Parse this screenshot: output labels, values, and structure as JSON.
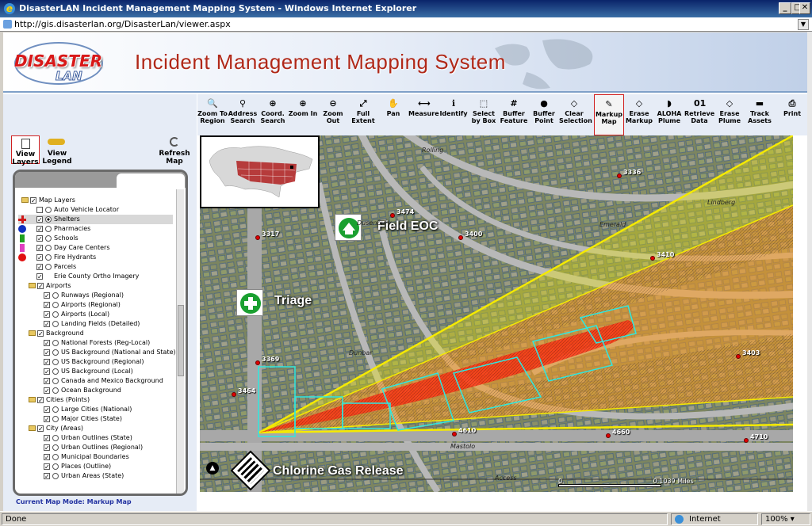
{
  "window": {
    "title": "DisasterLAN Incident Management Mapping System - Windows Internet Explorer",
    "url": "http://gis.disasterlan.org/DisasterLan/viewer.aspx"
  },
  "banner": {
    "logo_top": "DISASTER",
    "logo_bottom": "LAN",
    "title": "Incident Management Mapping System"
  },
  "left_buttons": {
    "view_layers": "View Layers",
    "view_legend": "View Legend",
    "refresh_map": "Refresh Map"
  },
  "layers": [
    {
      "label": "Map Layers",
      "kind": "folder",
      "indent": 0
    },
    {
      "label": "Auto Vehicle Locator",
      "kind": "layer",
      "indent": 1,
      "checked": false
    },
    {
      "label": "Shelters",
      "kind": "layer",
      "indent": 1,
      "checked": true,
      "selected": true,
      "symbol": "cross"
    },
    {
      "label": "Pharmacies",
      "kind": "layer",
      "indent": 1,
      "checked": true,
      "symbol": "blue-circle"
    },
    {
      "label": "Schools",
      "kind": "layer",
      "indent": 1,
      "checked": true,
      "symbol": "green-flag"
    },
    {
      "label": "Day Care Centers",
      "kind": "layer",
      "indent": 1,
      "checked": true,
      "symbol": "pink-flag"
    },
    {
      "label": "Fire Hydrants",
      "kind": "layer",
      "indent": 1,
      "checked": true,
      "symbol": "red-circle"
    },
    {
      "label": "Parcels",
      "kind": "layer",
      "indent": 1,
      "checked": true
    },
    {
      "label": "Erie County Ortho Imagery",
      "kind": "layer",
      "indent": 1,
      "checked": true,
      "noradio": true
    },
    {
      "label": "Airports",
      "kind": "folder",
      "indent": 1
    },
    {
      "label": "Runways (Regional)",
      "kind": "layer",
      "indent": 2,
      "checked": true
    },
    {
      "label": "Airports (Regional)",
      "kind": "layer",
      "indent": 2,
      "checked": true
    },
    {
      "label": "Airports (Local)",
      "kind": "layer",
      "indent": 2,
      "checked": true
    },
    {
      "label": "Landing Fields (Detailed)",
      "kind": "layer",
      "indent": 2,
      "checked": true
    },
    {
      "label": "Background",
      "kind": "folder",
      "indent": 1
    },
    {
      "label": "National Forests (Reg-Local)",
      "kind": "layer",
      "indent": 2,
      "checked": true
    },
    {
      "label": "US Background (National and State)",
      "kind": "layer",
      "indent": 2,
      "checked": true
    },
    {
      "label": "US Background (Regional)",
      "kind": "layer",
      "indent": 2,
      "checked": true
    },
    {
      "label": "US Background (Local)",
      "kind": "layer",
      "indent": 2,
      "checked": true
    },
    {
      "label": "Canada and Mexico Background",
      "kind": "layer",
      "indent": 2,
      "checked": true
    },
    {
      "label": "Ocean Background",
      "kind": "layer",
      "indent": 2,
      "checked": true
    },
    {
      "label": "Cities (Points)",
      "kind": "folder",
      "indent": 1
    },
    {
      "label": "Large Cities (National)",
      "kind": "layer",
      "indent": 2,
      "checked": true
    },
    {
      "label": "Major Cities (State)",
      "kind": "layer",
      "indent": 2,
      "checked": true
    },
    {
      "label": "City (Areas)",
      "kind": "folder",
      "indent": 1
    },
    {
      "label": "Urban Outlines (State)",
      "kind": "layer",
      "indent": 2,
      "checked": true
    },
    {
      "label": "Urban Outlines (Regional)",
      "kind": "layer",
      "indent": 2,
      "checked": true
    },
    {
      "label": "Municipal Boundaries",
      "kind": "layer",
      "indent": 2,
      "checked": true
    },
    {
      "label": "Places (Outline)",
      "kind": "layer",
      "indent": 2,
      "checked": true
    },
    {
      "label": "Urban Areas (State)",
      "kind": "layer",
      "indent": 2,
      "checked": true
    }
  ],
  "map_mode": "Current Map Mode: Markup Map",
  "tools": [
    {
      "label": "Zoom To Region",
      "icon": "zoom-region-icon",
      "glyph": "🔍"
    },
    {
      "label": "Address Search",
      "icon": "binoculars-icon",
      "glyph": "⚲"
    },
    {
      "label": "Coord. Search",
      "icon": "crosshair-icon",
      "glyph": "⊕"
    },
    {
      "label": "Zoom In",
      "icon": "zoom-in-icon",
      "glyph": "⊕"
    },
    {
      "label": "Zoom Out",
      "icon": "zoom-out-icon",
      "glyph": "⊖"
    },
    {
      "label": "Full Extent",
      "icon": "full-extent-icon",
      "glyph": "⤢"
    },
    {
      "label": "Pan",
      "icon": "hand-icon",
      "glyph": "✋"
    },
    {
      "label": "Measure",
      "icon": "measure-icon",
      "glyph": "⟷"
    },
    {
      "label": "Identify",
      "icon": "info-icon",
      "glyph": "ℹ"
    },
    {
      "label": "Select by Box",
      "icon": "select-box-icon",
      "glyph": "⬚"
    },
    {
      "label": "Buffer Feature",
      "icon": "buffer-feature-icon",
      "glyph": "#"
    },
    {
      "label": "Buffer Point",
      "icon": "buffer-point-icon",
      "glyph": "●"
    },
    {
      "label": "Clear Selection",
      "icon": "clear-selection-icon",
      "glyph": "◇"
    },
    {
      "label": "Markup Map",
      "icon": "pencil-icon",
      "glyph": "✎",
      "active": true
    },
    {
      "label": "Erase Markup",
      "icon": "eraser-icon",
      "glyph": "◇"
    },
    {
      "label": "ALOHA Plume",
      "icon": "plume-icon",
      "glyph": "◗"
    },
    {
      "label": "Retrieve Data",
      "icon": "binary-data-icon",
      "glyph": "01"
    },
    {
      "label": "Erase Plume",
      "icon": "erase-plume-icon",
      "glyph": "◇"
    },
    {
      "label": "Track Assets",
      "icon": "truck-icon",
      "glyph": "▬"
    },
    {
      "label": "Print",
      "icon": "printer-icon",
      "glyph": "⎙"
    }
  ],
  "map": {
    "labels": {
      "field_eoc": "Field EOC",
      "triage": "Triage",
      "chlorine": "Chlorine Gas Release"
    },
    "addresses": [
      "3336",
      "3474",
      "3317",
      "3400",
      "3410",
      "3403",
      "3369",
      "3464",
      "4610",
      "4660",
      "4710"
    ],
    "streets": [
      "Rolling",
      "Dusenbury",
      "Dunbar",
      "Emerald",
      "Lindberg",
      "Mastolo",
      "Access"
    ],
    "scale": {
      "min": "0",
      "max": "0.1039 Miles"
    }
  },
  "status": {
    "left": "Done",
    "zone": "Internet",
    "zoom": "100%"
  }
}
